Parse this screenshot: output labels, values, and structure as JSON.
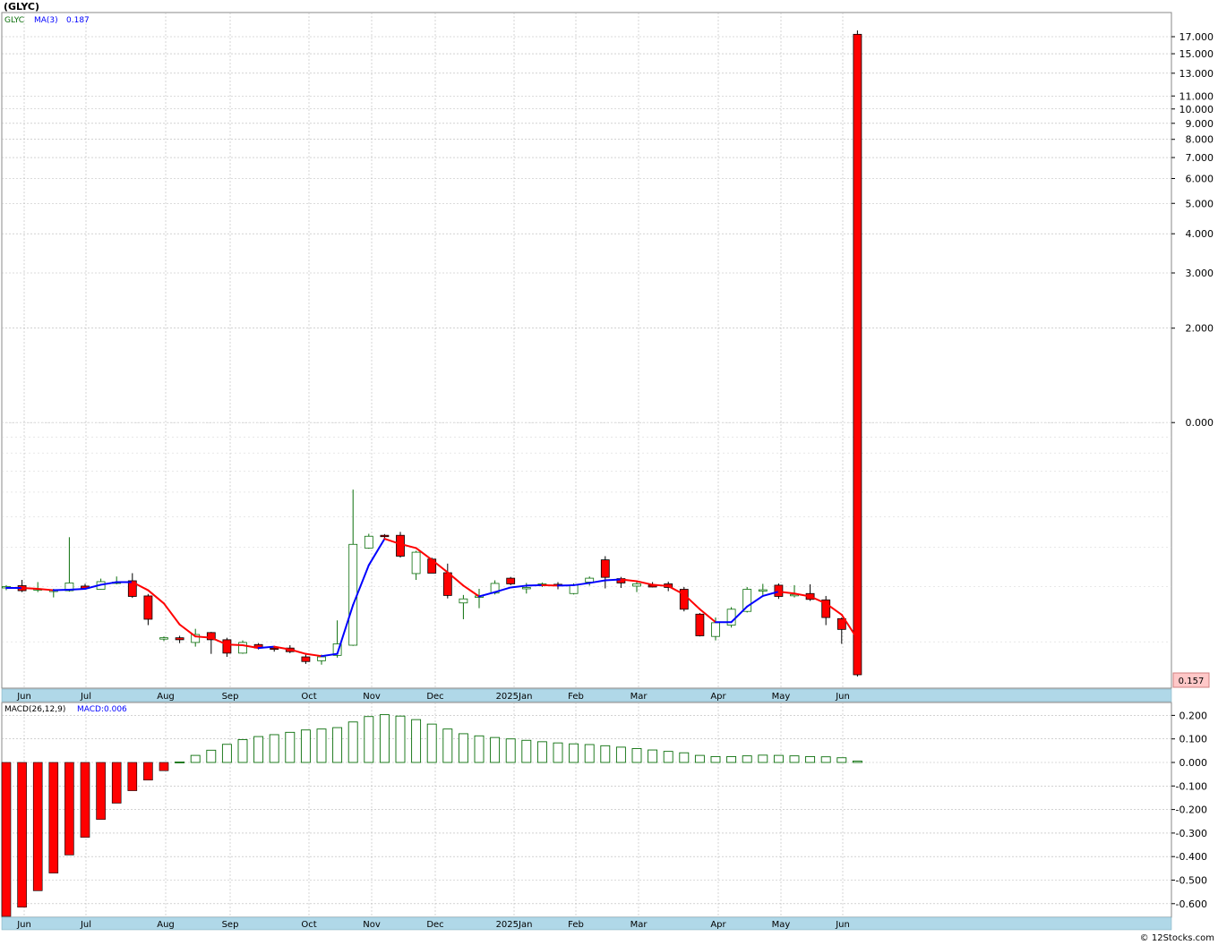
{
  "header": {
    "title": "(GLYC)",
    "footer": "© 12Stocks.com"
  },
  "colors": {
    "up": "#0a6e0a",
    "down": "#ff0000",
    "ma_up": "#0000ff",
    "ma_down": "#ff0000",
    "grid": "#b8b8b8",
    "axis_band": "#b0d8e8"
  },
  "chart_data": [
    {
      "type": "candlestick",
      "name": "price",
      "legend": {
        "symbol": "GLYC",
        "ma_label": "MA(3)",
        "ma_value": "0.187"
      },
      "y_scale": "log",
      "y_ticks": [
        {
          "v": 17.0,
          "l": "17.000"
        },
        {
          "v": 15.0,
          "l": "15.000"
        },
        {
          "v": 13.0,
          "l": "13.000"
        },
        {
          "v": 11.0,
          "l": "11.000"
        },
        {
          "v": 10.0,
          "l": "10.000"
        },
        {
          "v": 9.0,
          "l": "9.000"
        },
        {
          "v": 8.0,
          "l": "8.000"
        },
        {
          "v": 7.0,
          "l": "7.000"
        },
        {
          "v": 6.0,
          "l": "6.000"
        },
        {
          "v": 5.0,
          "l": "5.000"
        },
        {
          "v": 4.0,
          "l": "4.000"
        },
        {
          "v": 3.0,
          "l": "3.000"
        },
        {
          "v": 2.0,
          "l": "2.000"
        },
        {
          "v": 1.0,
          "l": "0.000"
        }
      ],
      "last_price_label": "0.157",
      "x_labels": [
        "Jun",
        "Jul",
        "Aug",
        "Sep",
        "Oct",
        "Nov",
        "Dec",
        "2025Jan",
        "Feb",
        "Mar",
        "Apr",
        "May",
        "Jun"
      ],
      "candles": [
        {
          "o": 0.297,
          "h": 0.303,
          "l": 0.292,
          "c": 0.3
        },
        {
          "o": 0.302,
          "h": 0.315,
          "l": 0.288,
          "c": 0.291
        },
        {
          "o": 0.294,
          "h": 0.31,
          "l": 0.288,
          "c": 0.295
        },
        {
          "o": 0.292,
          "h": 0.295,
          "l": 0.277,
          "c": 0.292
        },
        {
          "o": 0.291,
          "h": 0.431,
          "l": 0.289,
          "c": 0.308
        },
        {
          "o": 0.301,
          "h": 0.306,
          "l": 0.295,
          "c": 0.296
        },
        {
          "o": 0.294,
          "h": 0.318,
          "l": 0.293,
          "c": 0.311
        },
        {
          "o": 0.308,
          "h": 0.323,
          "l": 0.305,
          "c": 0.31
        },
        {
          "o": 0.313,
          "h": 0.331,
          "l": 0.276,
          "c": 0.279
        },
        {
          "o": 0.28,
          "h": 0.284,
          "l": 0.226,
          "c": 0.236
        },
        {
          "o": 0.206,
          "h": 0.208,
          "l": 0.201,
          "c": 0.206
        },
        {
          "o": 0.206,
          "h": 0.209,
          "l": 0.198,
          "c": 0.203
        },
        {
          "o": 0.199,
          "h": 0.22,
          "l": 0.193,
          "c": 0.211
        },
        {
          "o": 0.214,
          "h": 0.215,
          "l": 0.183,
          "c": 0.203
        },
        {
          "o": 0.203,
          "h": 0.206,
          "l": 0.179,
          "c": 0.184
        },
        {
          "o": 0.184,
          "h": 0.202,
          "l": 0.183,
          "c": 0.199
        },
        {
          "o": 0.196,
          "h": 0.198,
          "l": 0.189,
          "c": 0.191
        },
        {
          "o": 0.191,
          "h": 0.194,
          "l": 0.186,
          "c": 0.19
        },
        {
          "o": 0.191,
          "h": 0.195,
          "l": 0.184,
          "c": 0.186
        },
        {
          "o": 0.179,
          "h": 0.182,
          "l": 0.17,
          "c": 0.173
        },
        {
          "o": 0.174,
          "h": 0.182,
          "l": 0.169,
          "c": 0.179
        },
        {
          "o": 0.181,
          "h": 0.234,
          "l": 0.178,
          "c": 0.197
        },
        {
          "o": 0.195,
          "h": 0.611,
          "l": 0.194,
          "c": 0.409
        },
        {
          "o": 0.398,
          "h": 0.442,
          "l": 0.396,
          "c": 0.434
        },
        {
          "o": 0.437,
          "h": 0.441,
          "l": 0.424,
          "c": 0.434
        },
        {
          "o": 0.437,
          "h": 0.448,
          "l": 0.371,
          "c": 0.375
        },
        {
          "o": 0.33,
          "h": 0.39,
          "l": 0.315,
          "c": 0.386
        },
        {
          "o": 0.367,
          "h": 0.371,
          "l": 0.331,
          "c": 0.331
        },
        {
          "o": 0.332,
          "h": 0.355,
          "l": 0.275,
          "c": 0.281
        },
        {
          "o": 0.266,
          "h": 0.282,
          "l": 0.236,
          "c": 0.274
        },
        {
          "o": 0.277,
          "h": 0.295,
          "l": 0.256,
          "c": 0.28
        },
        {
          "o": 0.286,
          "h": 0.314,
          "l": 0.283,
          "c": 0.307
        },
        {
          "o": 0.319,
          "h": 0.322,
          "l": 0.303,
          "c": 0.306
        },
        {
          "o": 0.298,
          "h": 0.308,
          "l": 0.285,
          "c": 0.298
        },
        {
          "o": 0.304,
          "h": 0.309,
          "l": 0.299,
          "c": 0.306
        },
        {
          "o": 0.305,
          "h": 0.31,
          "l": 0.294,
          "c": 0.302
        },
        {
          "o": 0.285,
          "h": 0.307,
          "l": 0.283,
          "c": 0.303
        },
        {
          "o": 0.31,
          "h": 0.323,
          "l": 0.302,
          "c": 0.319
        },
        {
          "o": 0.365,
          "h": 0.375,
          "l": 0.296,
          "c": 0.321
        },
        {
          "o": 0.318,
          "h": 0.322,
          "l": 0.297,
          "c": 0.308
        },
        {
          "o": 0.301,
          "h": 0.312,
          "l": 0.288,
          "c": 0.306
        },
        {
          "o": 0.303,
          "h": 0.31,
          "l": 0.298,
          "c": 0.299
        },
        {
          "o": 0.306,
          "h": 0.311,
          "l": 0.29,
          "c": 0.298
        },
        {
          "o": 0.294,
          "h": 0.299,
          "l": 0.25,
          "c": 0.254
        },
        {
          "o": 0.245,
          "h": 0.247,
          "l": 0.208,
          "c": 0.209
        },
        {
          "o": 0.208,
          "h": 0.239,
          "l": 0.202,
          "c": 0.23
        },
        {
          "o": 0.226,
          "h": 0.258,
          "l": 0.222,
          "c": 0.254
        },
        {
          "o": 0.25,
          "h": 0.299,
          "l": 0.248,
          "c": 0.294
        },
        {
          "o": 0.293,
          "h": 0.306,
          "l": 0.282,
          "c": 0.293
        },
        {
          "o": 0.303,
          "h": 0.307,
          "l": 0.274,
          "c": 0.279
        },
        {
          "o": 0.283,
          "h": 0.303,
          "l": 0.277,
          "c": 0.283
        },
        {
          "o": 0.285,
          "h": 0.305,
          "l": 0.27,
          "c": 0.273
        },
        {
          "o": 0.272,
          "h": 0.28,
          "l": 0.226,
          "c": 0.239
        },
        {
          "o": 0.237,
          "h": 0.239,
          "l": 0.197,
          "c": 0.219
        },
        {
          "o": 17.3,
          "h": 17.8,
          "l": 0.155,
          "c": 0.157
        }
      ],
      "ma": [
        0.297,
        0.297,
        0.295,
        0.292,
        0.293,
        0.295,
        0.304,
        0.31,
        0.31,
        0.292,
        0.265,
        0.227,
        0.208,
        0.206,
        0.196,
        0.195,
        0.191,
        0.193,
        0.189,
        0.183,
        0.18,
        0.183,
        0.262,
        0.351,
        0.426,
        0.41,
        0.398,
        0.365,
        0.333,
        0.302,
        0.279,
        0.288,
        0.298,
        0.302,
        0.303,
        0.302,
        0.303,
        0.308,
        0.314,
        0.316,
        0.312,
        0.304,
        0.301,
        0.283,
        0.254,
        0.231,
        0.231,
        0.259,
        0.28,
        0.289,
        0.285,
        0.279,
        0.265,
        0.244,
        0.204
      ]
    },
    {
      "type": "bar",
      "name": "macd",
      "legend": {
        "label": "MACD(26,12,9)",
        "value": "MACD:0.006"
      },
      "ylim": [
        -0.66,
        0.21
      ],
      "y_ticks": [
        {
          "v": 0.2,
          "l": "0.200"
        },
        {
          "v": 0.1,
          "l": "0.100"
        },
        {
          "v": 0.0,
          "l": "0.000"
        },
        {
          "v": -0.1,
          "l": "-0.100"
        },
        {
          "v": -0.2,
          "l": "-0.200"
        },
        {
          "v": -0.3,
          "l": "-0.300"
        },
        {
          "v": -0.4,
          "l": "-0.400"
        },
        {
          "v": -0.5,
          "l": "-0.500"
        },
        {
          "v": -0.6,
          "l": "-0.600"
        }
      ],
      "x_labels": [
        "Jun",
        "Jul",
        "Aug",
        "Sep",
        "Oct",
        "Nov",
        "Dec",
        "2025Jan",
        "Feb",
        "Mar",
        "Apr",
        "May",
        "Jun"
      ],
      "values": [
        -0.66,
        -0.615,
        -0.545,
        -0.47,
        -0.393,
        -0.318,
        -0.242,
        -0.173,
        -0.12,
        -0.075,
        -0.035,
        0.002,
        0.03,
        0.052,
        0.077,
        0.097,
        0.11,
        0.118,
        0.128,
        0.138,
        0.142,
        0.148,
        0.172,
        0.195,
        0.203,
        0.197,
        0.182,
        0.163,
        0.142,
        0.122,
        0.113,
        0.106,
        0.1,
        0.094,
        0.088,
        0.083,
        0.079,
        0.076,
        0.071,
        0.065,
        0.059,
        0.053,
        0.047,
        0.041,
        0.03,
        0.025,
        0.025,
        0.028,
        0.031,
        0.03,
        0.028,
        0.025,
        0.024,
        0.02,
        0.006
      ]
    }
  ]
}
